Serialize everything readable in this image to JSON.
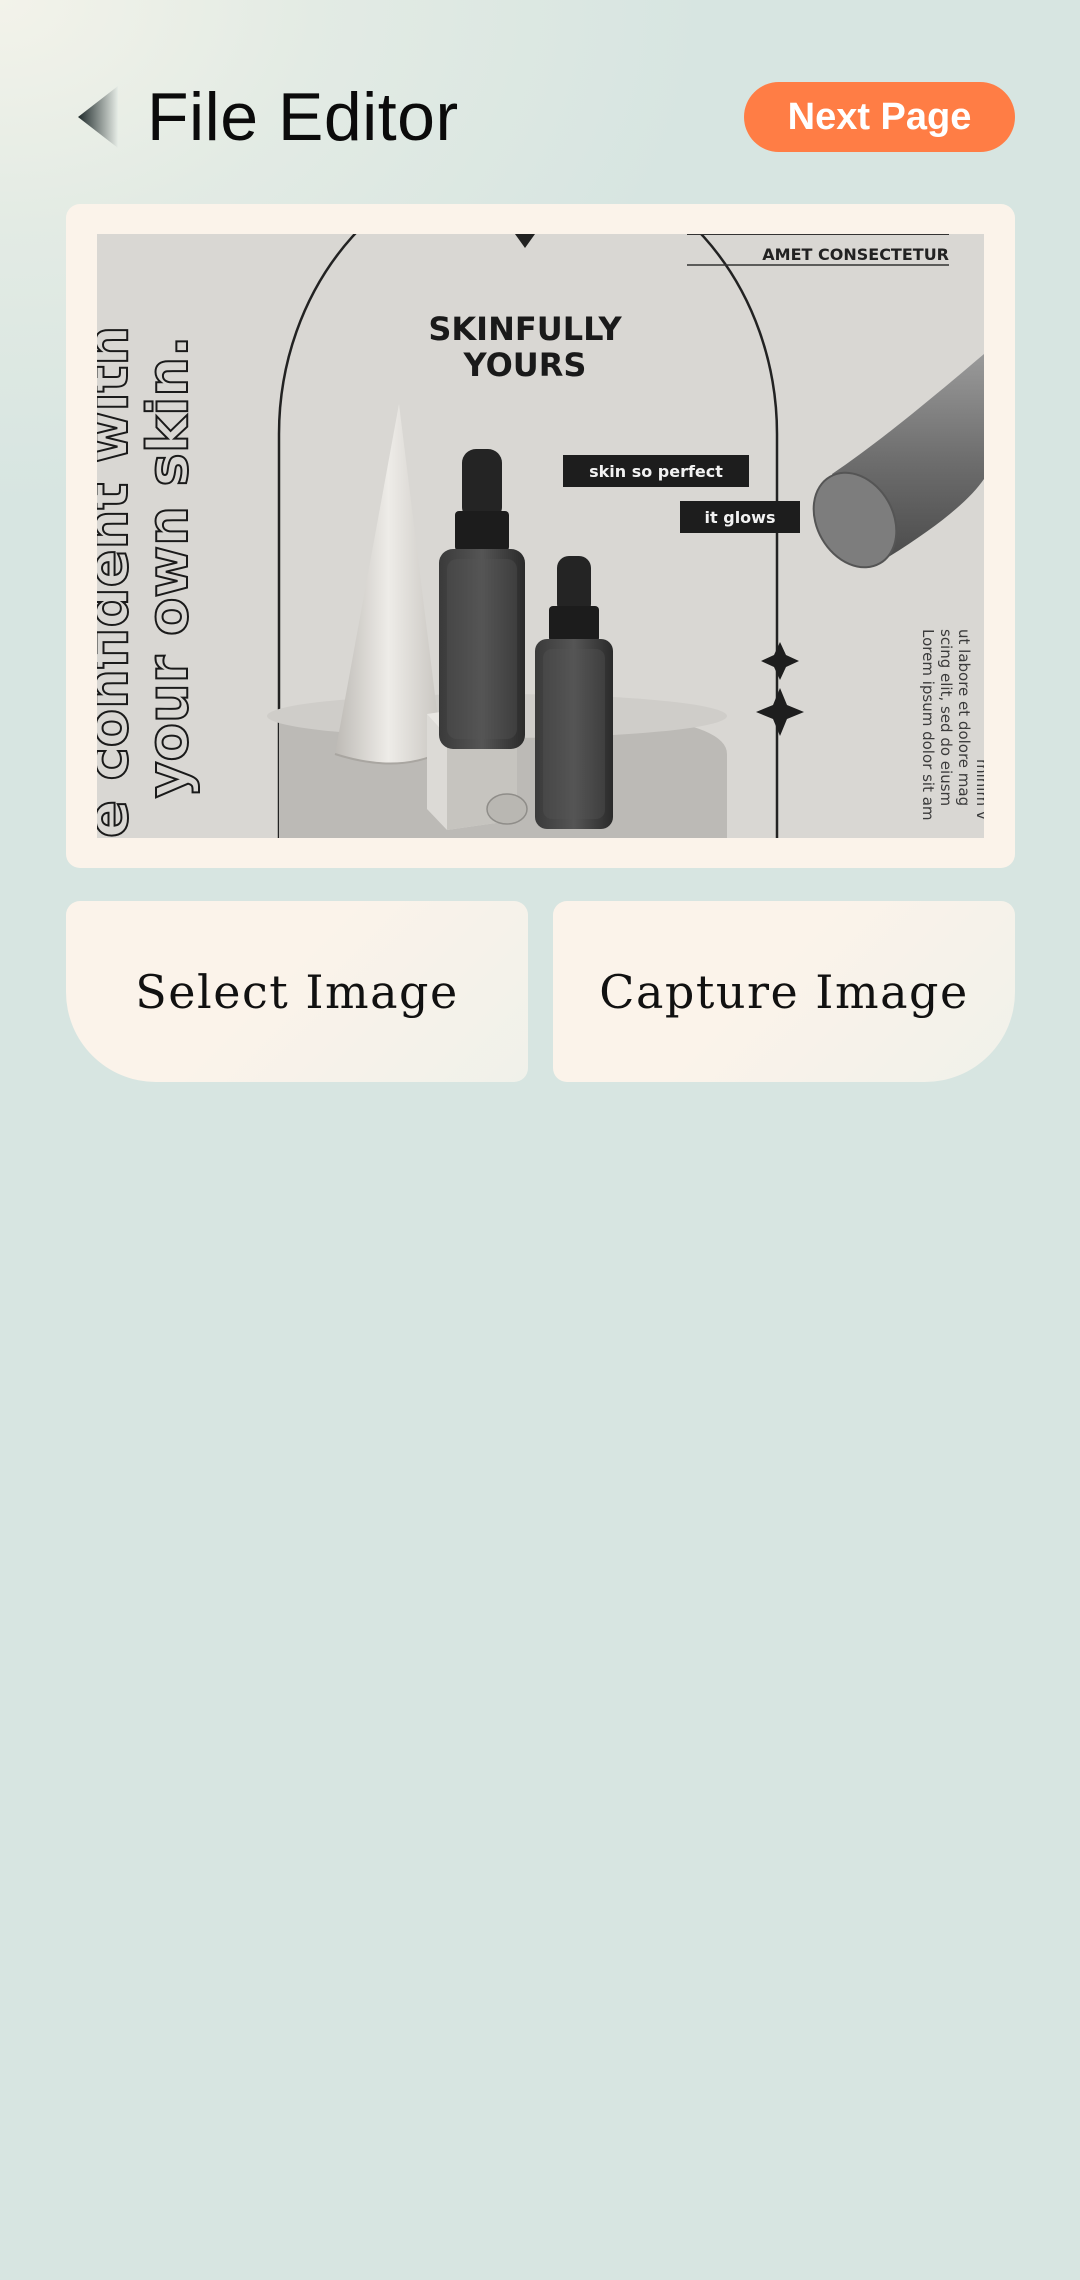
{
  "header": {
    "title": "File Editor",
    "next_label": "Next Page"
  },
  "preview": {
    "side_text_1": "e confident with",
    "side_text_2": "your own skin.",
    "heading_1": "SKINFULLY",
    "heading_2": "YOURS",
    "top_right": "AMET CONSECTETUR",
    "tag_1": "skin so perfect",
    "tag_2": "it glows",
    "lorem_1": "Lorem ipsum dolor sit am",
    "lorem_2": "scing elit, sed do eiusm",
    "lorem_3": "ut labore et dolore mag",
    "lorem_4": "minim v"
  },
  "actions": {
    "select_label": "Select Image",
    "capture_label": "Capture Image"
  },
  "colors": {
    "accent": "#ff7d45",
    "card": "#fbf3ea",
    "background": "#d7e5e1"
  }
}
